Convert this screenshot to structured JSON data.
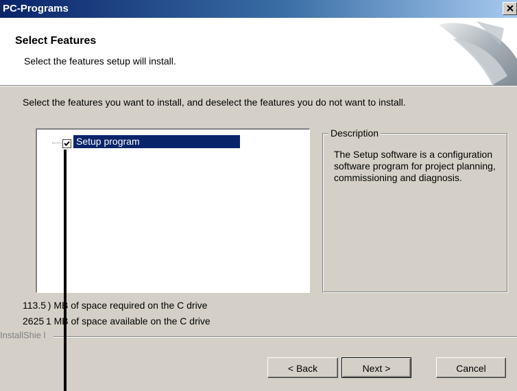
{
  "window": {
    "title": "PC-Programs"
  },
  "header": {
    "title": "Select Features",
    "subtitle": "Select the features setup will install."
  },
  "instruction": "Select the features you want to install, and deselect the features you do not want to install.",
  "tree": {
    "items": [
      {
        "label": "Setup program",
        "checked": true,
        "selected": true
      }
    ]
  },
  "description": {
    "legend": "Description",
    "text": "The Setup software is a configuration software program for project planning, commissioning and diagnosis."
  },
  "space": {
    "required": "113.5 ) MB of space required on the C drive",
    "available": "2625 1 MB of space available on the C drive"
  },
  "branding": "InstallShie l",
  "buttons": {
    "back": "< Back",
    "next": "Next >",
    "cancel": "Cancel"
  },
  "icons": {
    "close": "close-icon",
    "check": "checkmark-icon",
    "logo": "installer-graphic"
  },
  "colors": {
    "titlebar": "#0a246a",
    "selection": "#0a246a",
    "face": "#d4d0c8"
  }
}
